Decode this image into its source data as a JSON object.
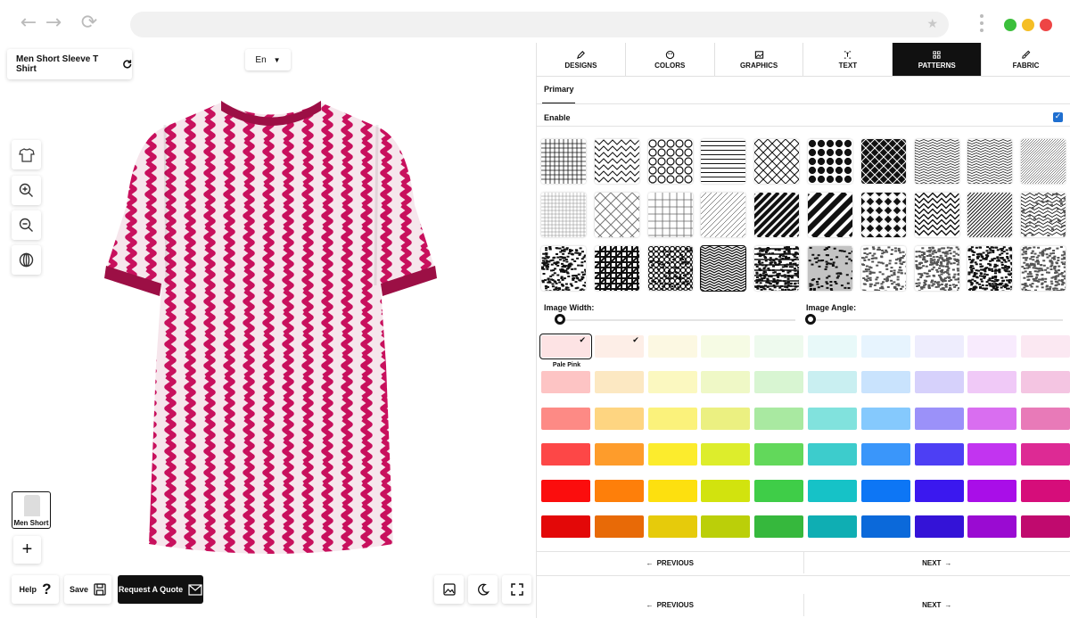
{
  "browser": {
    "back_icon": "arrow-left-icon",
    "forward_icon": "arrow-right-icon",
    "reload_icon": "reload-icon",
    "window_dots": [
      "#3bbf3b",
      "#f5be25",
      "#ee4545"
    ]
  },
  "left_panel": {
    "product_label": "Men Short Sleeve T Shirt",
    "language": "En",
    "tools": [
      "shirt-icon",
      "zoom-in-icon",
      "zoom-out-icon",
      "rotate-icon"
    ],
    "thumbnail_label": "Men Short",
    "add_label": "+",
    "help_label": "Help",
    "help_symbol": "?",
    "save_label": "Save",
    "quote_label": "Request A Quote",
    "shirt_colors": {
      "base": "#f6e6ec",
      "stripe": "#c8105d",
      "trim": "#9c0f45"
    }
  },
  "right_panel": {
    "tabs": [
      {
        "label": "DESIGNS",
        "icon": "pen-icon",
        "active": false
      },
      {
        "label": "COLORS",
        "icon": "palette-icon",
        "active": false
      },
      {
        "label": "GRAPHICS",
        "icon": "image-icon",
        "active": false
      },
      {
        "label": "TEXT",
        "icon": "text-icon",
        "active": false
      },
      {
        "label": "PATTERNS",
        "icon": "grid-icon",
        "active": true
      },
      {
        "label": "FABRIC",
        "icon": "brush-icon",
        "active": false
      }
    ],
    "subtab": "Primary",
    "enable_label": "Enable",
    "enable_checked": true,
    "image_width_label": "Image Width:",
    "image_angle_label": "Image Angle:",
    "image_width_value": 0,
    "image_angle_value": 0,
    "selected_color_label": "Pale Pink",
    "colors": [
      [
        "#fde3e4",
        "#fdeee7",
        "#fcf8e2",
        "#f6fbe4",
        "#eefaee",
        "#e8f9f9",
        "#e7f4fe",
        "#eeedfd",
        "#f8ebfd",
        "#fbe8f2"
      ],
      [
        "#fdc4c4",
        "#fce8c2",
        "#fbf8c0",
        "#eff8c6",
        "#d8f5d2",
        "#c9eff1",
        "#c9e3fd",
        "#d6d1fb",
        "#f0c9f7",
        "#f4c5e2"
      ],
      [
        "#fd8a85",
        "#fed581",
        "#fbf27b",
        "#ebf081",
        "#a9e9a1",
        "#81e2dd",
        "#85c9fd",
        "#9b91f9",
        "#d96ef0",
        "#e87ab8"
      ],
      [
        "#fd4747",
        "#fe9c2b",
        "#fcec2d",
        "#dded2c",
        "#62d85b",
        "#3dcccc",
        "#3a96fa",
        "#4d3ff4",
        "#c234f0",
        "#dd2a94"
      ],
      [
        "#fb0d0d",
        "#fe7f0a",
        "#fde00f",
        "#d2e30e",
        "#3fcd48",
        "#16c2c7",
        "#0d76f5",
        "#3b18ef",
        "#a90ee8",
        "#d60d7a"
      ],
      [
        "#e30808",
        "#e86a07",
        "#e6cb0b",
        "#bbcf09",
        "#36b83d",
        "#0faeb3",
        "#0b69da",
        "#3413d7",
        "#9a0bd2",
        "#c00a6e"
      ]
    ],
    "checked_swatches": [
      0,
      1
    ],
    "previous_label": "PREVIOUS",
    "next_label": "NEXT"
  }
}
